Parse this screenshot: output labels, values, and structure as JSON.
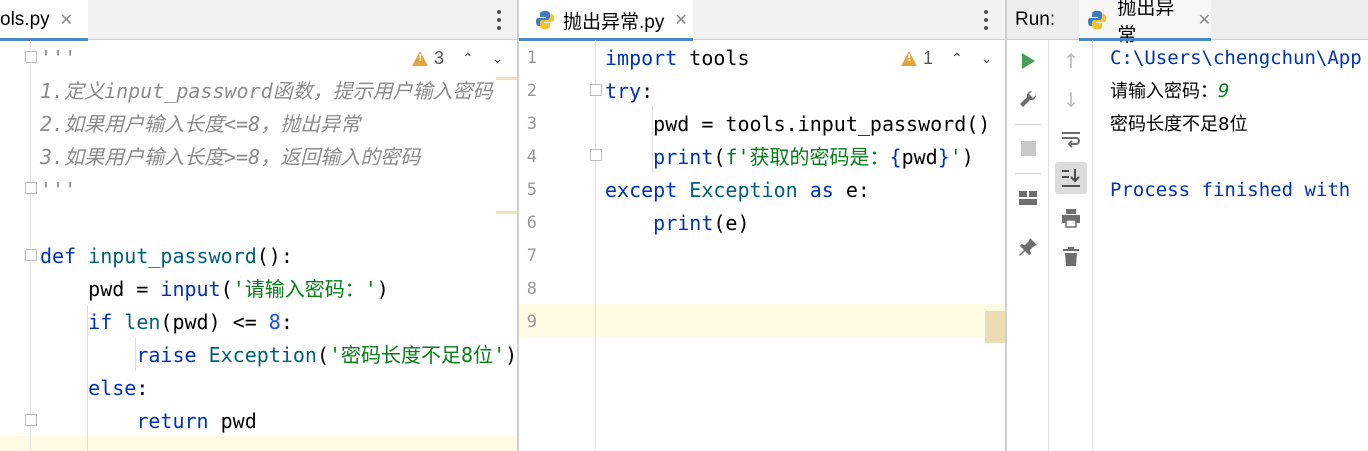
{
  "left_editor": {
    "tab_label": "ols.py",
    "tab_close": "✕",
    "warnings_count": "3",
    "lines": [
      [
        {
          "t": "'''",
          "c": "cmt"
        }
      ],
      [
        {
          "t": "1.定义input_password函数，提示用户输入密码",
          "c": "cmt"
        }
      ],
      [
        {
          "t": "2.如果用户输入长度<=8，抛出异常",
          "c": "cmt"
        }
      ],
      [
        {
          "t": "3.如果用户输入长度>=8，返回输入的密码",
          "c": "cmt"
        }
      ],
      [
        {
          "t": "'''",
          "c": "cmt"
        }
      ],
      [],
      [
        {
          "t": "def ",
          "c": "kw"
        },
        {
          "t": "input_password",
          "c": "fn"
        },
        {
          "t": "():",
          "c": ""
        }
      ],
      [
        {
          "t": "    pwd = ",
          "c": ""
        },
        {
          "t": "input",
          "c": "kw"
        },
        {
          "t": "(",
          "c": ""
        },
        {
          "t": "'请输入密码：'",
          "c": "str"
        },
        {
          "t": ")",
          "c": ""
        }
      ],
      [
        {
          "t": "    ",
          "c": ""
        },
        {
          "t": "if ",
          "c": "kw"
        },
        {
          "t": "len",
          "c": "fn"
        },
        {
          "t": "(pwd) <= ",
          "c": ""
        },
        {
          "t": "8",
          "c": "num"
        },
        {
          "t": ":",
          "c": ""
        }
      ],
      [
        {
          "t": "        ",
          "c": ""
        },
        {
          "t": "raise ",
          "c": "kw"
        },
        {
          "t": "Exception",
          "c": "fn"
        },
        {
          "t": "(",
          "c": ""
        },
        {
          "t": "'密码长度不足8位'",
          "c": "str"
        },
        {
          "t": ")",
          "c": ""
        }
      ],
      [
        {
          "t": "    ",
          "c": ""
        },
        {
          "t": "else",
          "c": "kw"
        },
        {
          "t": ":",
          "c": ""
        }
      ],
      [
        {
          "t": "        ",
          "c": ""
        },
        {
          "t": "return ",
          "c": "kw"
        },
        {
          "t": "pwd",
          "c": ""
        }
      ]
    ]
  },
  "middle_editor": {
    "tab_label": "抛出异常.py",
    "tab_close": "✕",
    "warnings_count": "1",
    "line_numbers": [
      "1",
      "2",
      "3",
      "4",
      "5",
      "6",
      "7",
      "8",
      "9"
    ],
    "lines": [
      [
        {
          "t": "import ",
          "c": "kw"
        },
        {
          "t": "tools",
          "c": ""
        }
      ],
      [
        {
          "t": "try",
          "c": "kw"
        },
        {
          "t": ":",
          "c": ""
        }
      ],
      [
        {
          "t": "    pwd = tools.input_password()",
          "c": ""
        }
      ],
      [
        {
          "t": "    ",
          "c": ""
        },
        {
          "t": "print",
          "c": "kw"
        },
        {
          "t": "(",
          "c": ""
        },
        {
          "t": "f'获取的密码是：",
          "c": "str"
        },
        {
          "t": "{",
          "c": "kw"
        },
        {
          "t": "pwd",
          "c": ""
        },
        {
          "t": "}",
          "c": "kw"
        },
        {
          "t": "'",
          "c": "str"
        },
        {
          "t": ")",
          "c": ""
        }
      ],
      [
        {
          "t": "except ",
          "c": "kw"
        },
        {
          "t": "Exception ",
          "c": "fn"
        },
        {
          "t": "as ",
          "c": "kw"
        },
        {
          "t": "e:",
          "c": ""
        }
      ],
      [
        {
          "t": "    ",
          "c": ""
        },
        {
          "t": "print",
          "c": "kw"
        },
        {
          "t": "(e)",
          "c": ""
        }
      ],
      [],
      [],
      []
    ]
  },
  "run_panel": {
    "label": "Run:",
    "tab_label": "抛出异常",
    "tab_close": "✕",
    "output": [
      {
        "t": "C:\\Users\\chengchun\\App",
        "style": "path"
      },
      {
        "t": "请输入密码：",
        "input": "9",
        "style": "prompt"
      },
      {
        "t": "密码长度不足8位",
        "style": "cn"
      },
      {
        "t": "",
        "style": "blank"
      },
      {
        "t": "Process finished with",
        "style": "process"
      }
    ]
  },
  "colors": {
    "keyword": "#0033b3",
    "function": "#00627a",
    "string": "#067d17",
    "number": "#1750eb",
    "comment": "#8c8c8c",
    "current_line": "#fffae3",
    "run_green": "#499c54",
    "tab_accent": "#4a88c7"
  }
}
